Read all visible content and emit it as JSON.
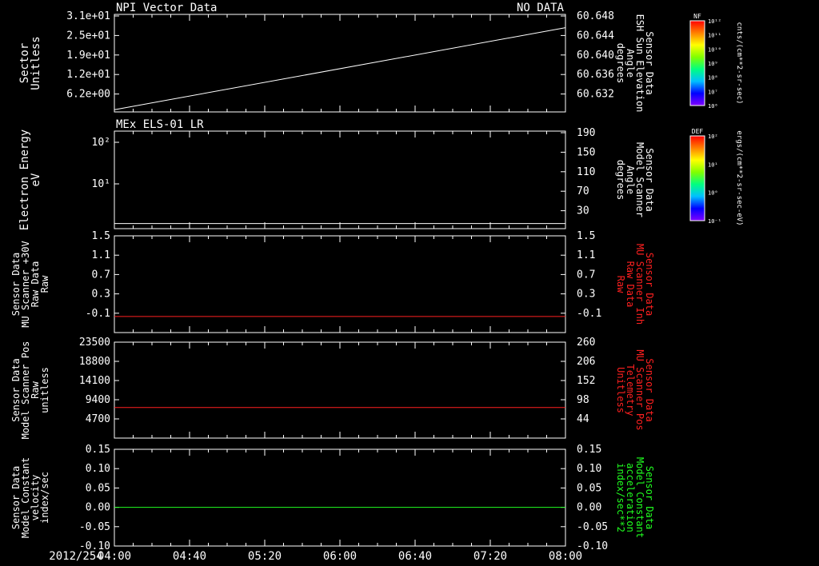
{
  "date_label": "2012/254",
  "time_ticks": [
    "04:00",
    "04:40",
    "05:20",
    "06:00",
    "06:40",
    "07:20",
    "08:00"
  ],
  "colorbars": [
    {
      "label": "NF",
      "units": "cnts/(cm**2-sr-sec)",
      "ticks": [
        "10¹²",
        "10¹¹",
        "10¹⁰",
        "10⁹",
        "10⁸",
        "10⁷",
        "10⁶"
      ]
    },
    {
      "label": "DEF",
      "units": "ergs/(cm**2-sr-sec-eV)",
      "ticks": [
        "10²",
        "10¹",
        "10⁰",
        "10⁻¹"
      ]
    }
  ],
  "chart_data": [
    {
      "type": "line",
      "title_left": "NPI Vector Data",
      "title_right": "NO DATA",
      "ylabel_left": [
        "Sector",
        "Unitless"
      ],
      "yticks_left": [
        "3.1e+01",
        "2.5e+01",
        "1.9e+01",
        "1.2e+01",
        "6.2e+00"
      ],
      "ylabel_right": [
        "Sensor Data",
        "ESH Sun Elevation",
        "Angle",
        "degrees"
      ],
      "yticks_right": [
        "60.648",
        "60.644",
        "60.640",
        "60.636",
        "60.632"
      ],
      "right_label_color": "#ffffff",
      "line_color": "#ffffff",
      "series": [
        {
          "x": [
            "04:00",
            "08:00"
          ],
          "y": [
            60.6285,
            60.647
          ]
        }
      ],
      "ylim_right": [
        60.628,
        60.65
      ]
    },
    {
      "type": "heatmap",
      "title_left": "MEx ELS-01 LR",
      "ylabel_left": [
        "Electron Energy",
        "eV"
      ],
      "yticks_left": [
        "10²",
        "10¹"
      ],
      "ylabel_right": [
        "Sensor Data",
        "Model Scanner",
        "Angle",
        "degrees"
      ],
      "yticks_right": [
        "190",
        "150",
        "110",
        "70",
        "30"
      ],
      "right_label_color": "#ffffff",
      "data_extent_x": [
        "04:00",
        "04:42"
      ],
      "overlay_line_y_right": 10,
      "ylim_right": [
        0,
        190
      ]
    },
    {
      "type": "line",
      "ylabel_left": [
        "Sensor Data",
        "MU Scanner +30V",
        "Raw Data",
        "Raw"
      ],
      "yticks_left": [
        "1.5",
        "1.1",
        "0.7",
        "0.3",
        "-0.1"
      ],
      "ylabel_right": [
        "Sensor Data",
        "MU Scanner Inh",
        "Raw Data",
        "Raw"
      ],
      "yticks_right": [
        "1.5",
        "1.1",
        "0.7",
        "0.3",
        "-0.1"
      ],
      "right_label_color": "#ff2020",
      "line_color": "#ff2020",
      "ylim": [
        -0.3,
        1.5
      ],
      "series": [
        {
          "x": [
            "04:00",
            "08:00"
          ],
          "y": [
            0.0,
            0.0
          ]
        }
      ]
    },
    {
      "type": "line",
      "ylabel_left": [
        "Sensor Data",
        "Model Scanner Pos",
        "Raw",
        "unitless"
      ],
      "yticks_left": [
        "23500",
        "18800",
        "14100",
        "9400",
        "4700"
      ],
      "ylabel_right": [
        "Sensor Data",
        "MU Scanner Pos",
        "Telemetry",
        "Unitless"
      ],
      "yticks_right": [
        "260",
        "206",
        "152",
        "98",
        "44"
      ],
      "right_label_color": "#ff2020",
      "line_color": "#ff2020",
      "ylim": [
        0,
        23500
      ],
      "series": [
        {
          "x": [
            "04:00",
            "08:00"
          ],
          "y": [
            7500,
            7500
          ]
        }
      ]
    },
    {
      "type": "line",
      "ylabel_left": [
        "Sensor Data",
        "Model Constant",
        "velocity",
        "index/sec"
      ],
      "yticks_left": [
        "0.15",
        "0.10",
        "0.05",
        "0.00",
        "-0.05",
        "-0.10"
      ],
      "ylabel_right": [
        "Sensor Data",
        "Model Constant",
        "acceleration",
        "index/sec**2"
      ],
      "yticks_right": [
        "0.15",
        "0.10",
        "0.05",
        "0.00",
        "-0.05",
        "-0.10"
      ],
      "right_label_color": "#20ff20",
      "line_color": "#20ff20",
      "ylim": [
        -0.1,
        0.15
      ],
      "series": [
        {
          "x": [
            "04:00",
            "08:00"
          ],
          "y": [
            0.0,
            0.0
          ]
        }
      ]
    }
  ]
}
